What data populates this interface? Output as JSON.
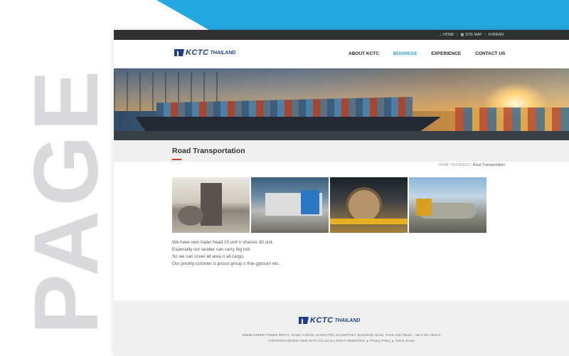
{
  "backdrop": {
    "watermark": "PAGE",
    "accent_color": "#24a8e0"
  },
  "topbar": {
    "links": [
      {
        "label": "HOME",
        "icon": "home-icon"
      },
      {
        "label": "SITE MAP",
        "icon": "sitemap-icon"
      },
      {
        "label": "KOREAN"
      }
    ]
  },
  "header": {
    "logo_text": "KCTC",
    "logo_sub": "THAILAND",
    "nav": [
      "ABOUT KCTC",
      "BUSINESS",
      "EXPERIENCE",
      "CONTACT US"
    ],
    "active_nav": "BUSINESS",
    "active_color": "#2a9fd6"
  },
  "page": {
    "title": "Road Transportation",
    "breadcrumb": [
      "HOME",
      "BUSINESS",
      "Road Transportation"
    ],
    "description": [
      "We have own trailer head 20 unit n shassis 30 unit.",
      "Especially our taraller can carry big coil.",
      "So we can cover all area n all cargo.",
      "Our priority cutomer is posco group n thai gypsum etc."
    ]
  },
  "footer": {
    "logo_text": "KCTC",
    "logo_sub": "THAILAND",
    "address": "3656/8 GREEN TOWER 3RD FL. RAMA 4 ROAD, KLONGTON, KLONGTOEY, BANGKOK 10110, THAILAND Phone : +66 2-367-3544-6",
    "copyright": "COPYRIGHT@2002~2008 KCTC CO.Ltd ALL RIGHT RESERVED",
    "privacy": "Privacy Policy",
    "terms": "Terms of Use"
  }
}
